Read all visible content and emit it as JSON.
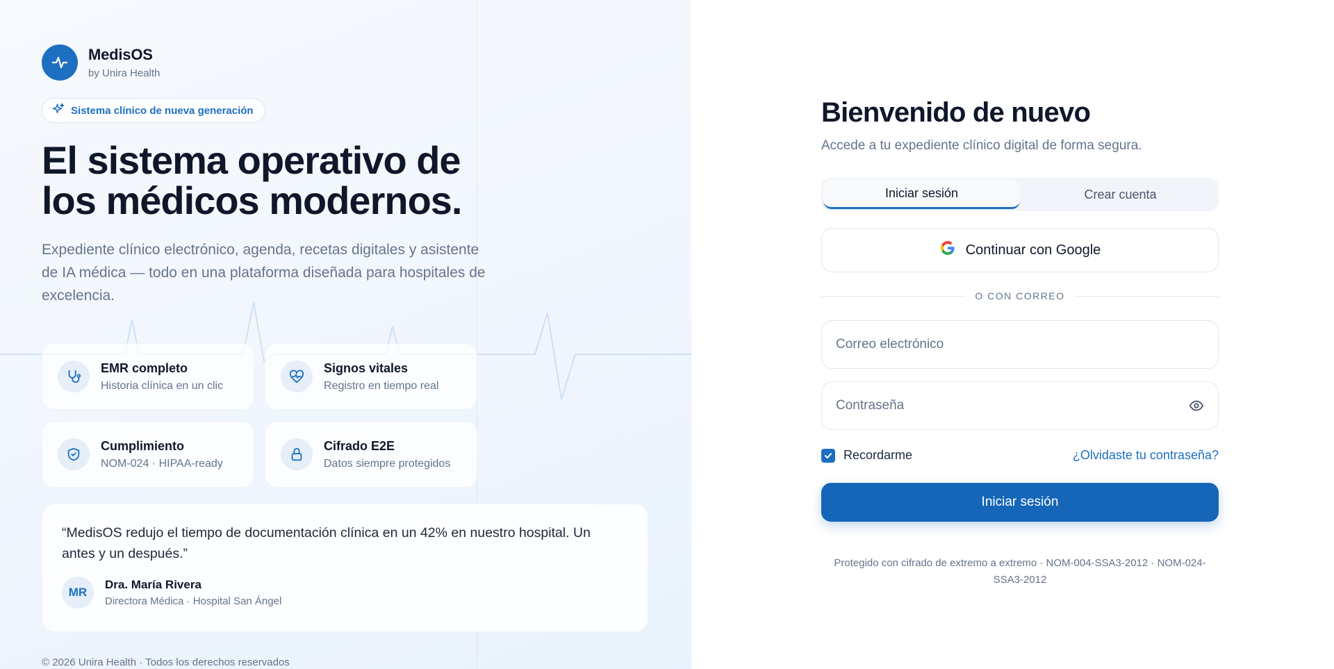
{
  "brand": {
    "name": "MedisOS",
    "sub": "by Unira Health",
    "logo_icon": "pulse-icon"
  },
  "hero": {
    "badge": "Sistema clínico de nueva generación",
    "headline_line1": "El sistema operativo de",
    "headline_line2": "los médicos modernos.",
    "subtext": "Expediente clínico electrónico, agenda, recetas digitales y asistente de IA médica — todo en una plataforma diseñada para hospitales de excelencia."
  },
  "features": [
    {
      "title": "EMR completo",
      "sub": "Historia clínica en un clic",
      "icon": "stethoscope-icon"
    },
    {
      "title": "Signos vitales",
      "sub": "Registro en tiempo real",
      "icon": "heart-pulse-icon"
    },
    {
      "title": "Cumplimiento",
      "sub": "NOM-024 · HIPAA-ready",
      "icon": "shield-check-icon"
    },
    {
      "title": "Cifrado E2E",
      "sub": "Datos siempre protegidos",
      "icon": "lock-icon"
    }
  ],
  "testimonial": {
    "quote": "“MedisOS redujo el tiempo de documentación clínica en un 42% en nuestro hospital. Un antes y un después.”",
    "initials": "MR",
    "author": "Dra. María Rivera",
    "role": "Directora Médica · Hospital San Ángel"
  },
  "copyright": "© 2026 Unira Health · Todos los derechos reservados",
  "login": {
    "title": "Bienvenido de nuevo",
    "subtitle": "Accede a tu expediente clínico digital de forma segura.",
    "tab_signin": "Iniciar sesión",
    "tab_signup": "Crear cuenta",
    "google_label": "Continuar con Google",
    "divider": "O CON CORREO",
    "email_placeholder": "Correo electrónico",
    "password_placeholder": "Contraseña",
    "remember": "Recordarme",
    "remember_checked": true,
    "forgot": "¿Olvidaste tu contraseña?",
    "submit": "Iniciar sesión",
    "legal": "Protegido con cifrado de extremo a extremo · NOM-004-SSA3-2012 · NOM-024-SSA3-2012"
  },
  "colors": {
    "accent": "#1d6fc2",
    "button": "#1566b8",
    "muted": "#64748b"
  }
}
